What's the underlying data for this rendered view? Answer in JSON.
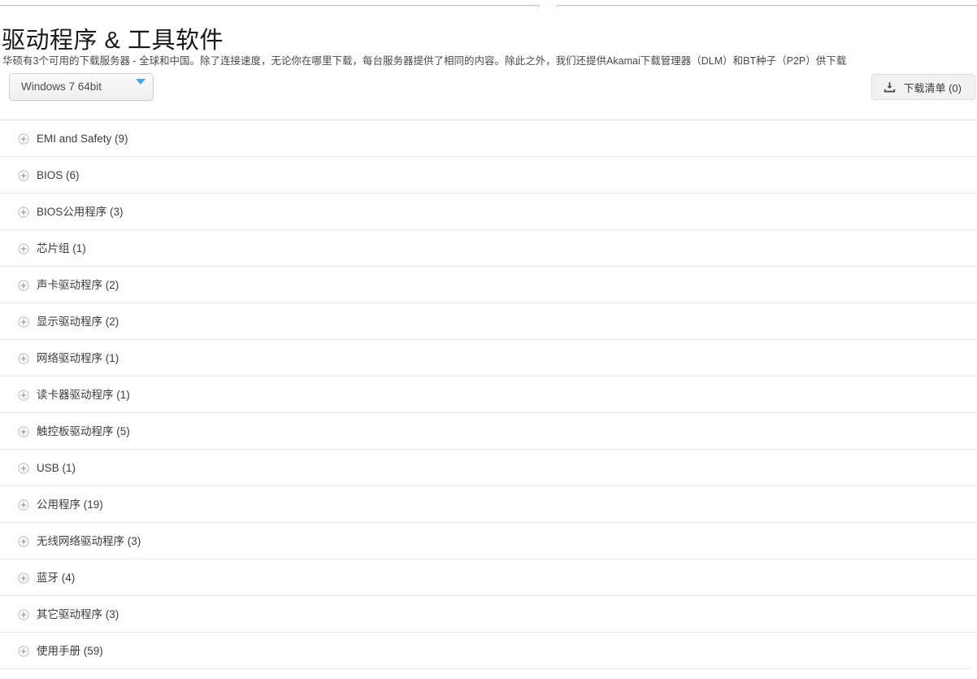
{
  "page": {
    "title": "驱动程序 & 工具软件",
    "description": "华硕有3个可用的下载服务器 - 全球和中国。除了连接速度，无论你在哪里下载，每台服务器提供了相同的内容。除此之外，我们还提供Akamai下载管理器（DLM）和BT种子（P2P）供下载"
  },
  "controls": {
    "os_select": {
      "value": "Windows 7 64bit",
      "caret_icon": "chevron-down-icon",
      "caret_color": "#3fa9e0"
    },
    "download_list_button": {
      "label": "下载清单 (0)",
      "count": 0,
      "icon": "download-icon"
    }
  },
  "accordion": {
    "expand_icon": "plus-circle-icon",
    "items": [
      {
        "label": "EMI and Safety  (9)",
        "name": "EMI and Safety",
        "count": 9
      },
      {
        "label": "BIOS (6)",
        "name": "BIOS",
        "count": 6
      },
      {
        "label": "BIOS公用程序 (3)",
        "name": "BIOS公用程序",
        "count": 3
      },
      {
        "label": "芯片组 (1)",
        "name": "芯片组",
        "count": 1
      },
      {
        "label": "声卡驱动程序 (2)",
        "name": "声卡驱动程序",
        "count": 2
      },
      {
        "label": "显示驱动程序 (2)",
        "name": "显示驱动程序",
        "count": 2
      },
      {
        "label": "网络驱动程序 (1)",
        "name": "网络驱动程序",
        "count": 1
      },
      {
        "label": "读卡器驱动程序 (1)",
        "name": "读卡器驱动程序",
        "count": 1
      },
      {
        "label": "触控板驱动程序 (5)",
        "name": "触控板驱动程序",
        "count": 5
      },
      {
        "label": "USB (1)",
        "name": "USB",
        "count": 1
      },
      {
        "label": "公用程序 (19)",
        "name": "公用程序",
        "count": 19
      },
      {
        "label": "无线网络驱动程序 (3)",
        "name": "无线网络驱动程序",
        "count": 3
      },
      {
        "label": "蓝牙 (4)",
        "name": "蓝牙",
        "count": 4
      },
      {
        "label": "其它驱动程序 (3)",
        "name": "其它驱动程序",
        "count": 3
      },
      {
        "label": "使用手册 (59)",
        "name": "使用手册",
        "count": 59
      }
    ]
  },
  "colors": {
    "text": "#3d3d3d",
    "title": "#1a1a1a",
    "rule": "#e6e6e6",
    "accent": "#3fa9e0",
    "button_bg": "#f2f2f2"
  }
}
